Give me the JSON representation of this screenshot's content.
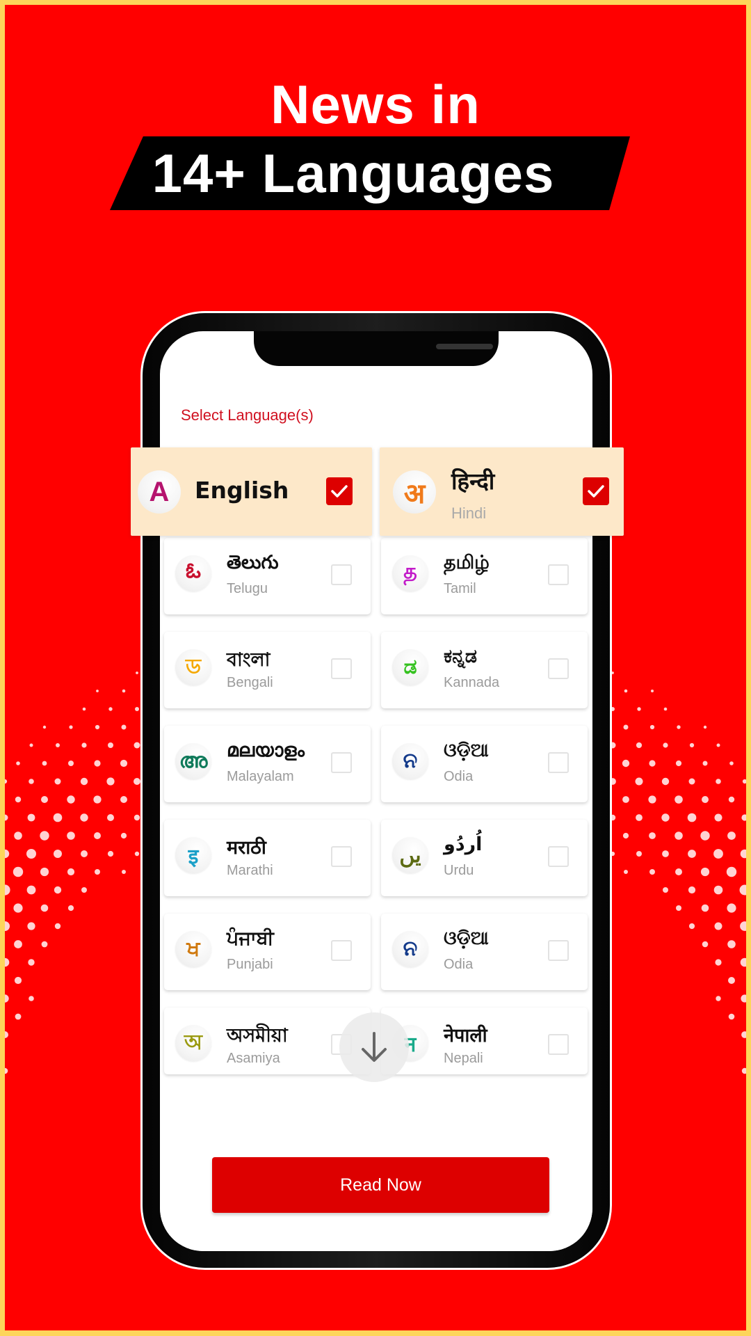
{
  "promo": {
    "headline": "News in",
    "banner": "14+ Languages"
  },
  "colors": {
    "background_red": "#FF0000",
    "border_yellow": "#FDD55A",
    "accent_red": "#DD0000",
    "selected_card_bg": "#FDE8C9"
  },
  "app": {
    "title": "Select Language(s)",
    "scroll_icon": "arrow-down-icon",
    "read_now_label": "Read Now",
    "selected": [
      {
        "native": "English",
        "english": "",
        "glyph": "A",
        "glyph_color": "#B5146E",
        "checked": true
      },
      {
        "native": "हिन्दी",
        "english": "Hindi",
        "glyph": "अ",
        "glyph_color": "#F07A1A",
        "checked": true
      }
    ],
    "languages": [
      {
        "native": "తెలుగు",
        "english": "Telugu",
        "glyph": "ఓ",
        "glyph_color": "#C8102E",
        "checked": false
      },
      {
        "native": "தமிழ்",
        "english": "Tamil",
        "glyph": "த",
        "glyph_color": "#C21BC9",
        "checked": false
      },
      {
        "native": "বাংলা",
        "english": "Bengali",
        "glyph": "ড",
        "glyph_color": "#F5A800",
        "checked": false
      },
      {
        "native": "ಕನ್ನಡ",
        "english": "Kannada",
        "glyph": "ಡ",
        "glyph_color": "#35C220",
        "checked": false
      },
      {
        "native": "മലയാളം",
        "english": "Malayalam",
        "glyph": "അ",
        "glyph_color": "#0F7A5A",
        "checked": false
      },
      {
        "native": "ଓଡ଼ିଆ",
        "english": "Odia",
        "glyph": "ନ",
        "glyph_color": "#133A8A",
        "checked": false
      },
      {
        "native": "मराठी",
        "english": "Marathi",
        "glyph": "इ",
        "glyph_color": "#1AA0C8",
        "checked": false
      },
      {
        "native": "اُردُو",
        "english": "Urdu",
        "glyph": "یں",
        "glyph_color": "#5C6A12",
        "checked": false
      },
      {
        "native": "ਪੰਜਾਬੀ",
        "english": "Punjabi",
        "glyph": "ਖ",
        "glyph_color": "#D07A10",
        "checked": false
      },
      {
        "native": "ଓଡ଼ିଆ",
        "english": "Odia",
        "glyph": "ନ",
        "glyph_color": "#133A8A",
        "checked": false
      },
      {
        "native": "অসমীয়া",
        "english": "Asamiya",
        "glyph": "অ",
        "glyph_color": "#9A9A10",
        "checked": false
      },
      {
        "native": "नेपाली",
        "english": "Nepali",
        "glyph": "न",
        "glyph_color": "#1AAA8A",
        "checked": false
      }
    ]
  }
}
